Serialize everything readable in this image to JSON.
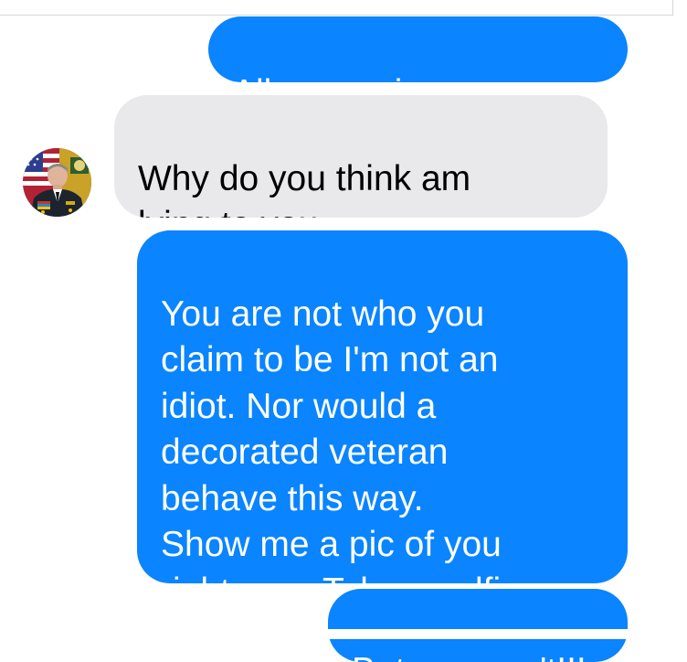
{
  "messages": [
    {
      "sender": "me",
      "text": "All news pics no way."
    },
    {
      "sender": "contact",
      "text": "Why do you think am\nlying to you"
    },
    {
      "sender": "me",
      "text": "You are not who you\nclaim to be I'm not an\nidiot. Nor would a\ndecorated veteran\nbehave this way.\nShow me a pic of you\nright now. Take a selfie."
    },
    {
      "sender": "me",
      "text": "Bet you can't!!!"
    }
  ],
  "colors": {
    "outgoing_bubble": "#0a84ff",
    "incoming_bubble": "#e9e9eb",
    "outgoing_text": "#ffffff",
    "incoming_text": "#000000"
  },
  "contact": {
    "avatar_icon": "military-portrait-avatar"
  }
}
